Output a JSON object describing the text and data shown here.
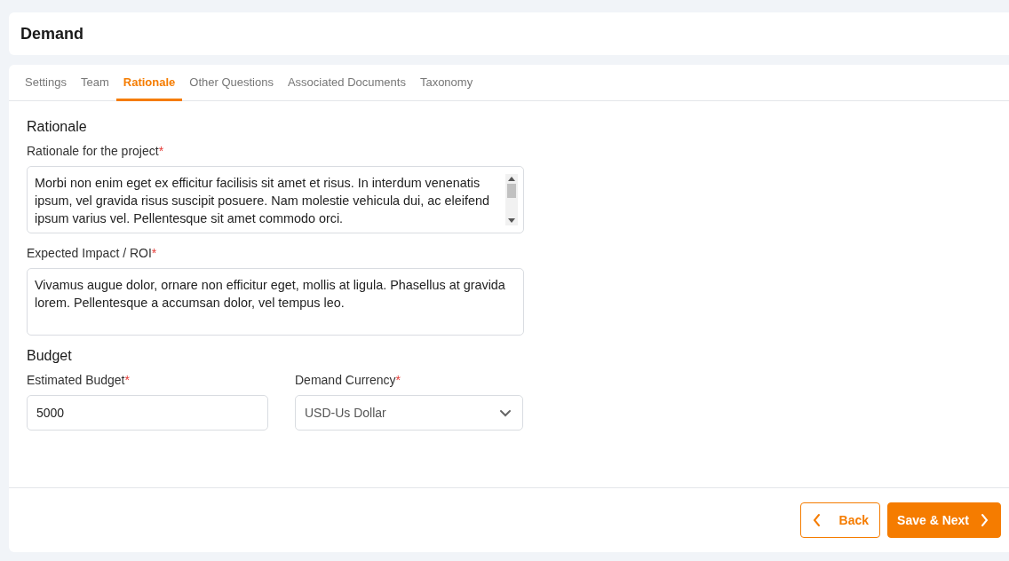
{
  "header": {
    "title": "Demand"
  },
  "tabs": [
    {
      "label": "Settings",
      "selected": false
    },
    {
      "label": "Team",
      "selected": false
    },
    {
      "label": "Rationale",
      "selected": true
    },
    {
      "label": "Other Questions",
      "selected": false
    },
    {
      "label": "Associated Documents",
      "selected": false
    },
    {
      "label": "Taxonomy",
      "selected": false
    }
  ],
  "sections": [
    {
      "title": "Rationale",
      "fields": [
        {
          "kind": "textarea",
          "label": "Rationale for the project",
          "required_mark": "*",
          "value": "Morbi non enim eget ex efficitur facilisis sit amet et risus. In interdum venenatis ipsum, vel gravida risus suscipit posuere. Nam molestie vehicula dui, ac eleifend ipsum varius vel. Pellentesque sit amet commodo orci.",
          "scrollable": true
        },
        {
          "kind": "textarea",
          "label": "Expected Impact / ROI",
          "required_mark": "*",
          "value": "Vivamus augue dolor, ornare non efficitur eget, mollis at ligula. Phasellus at gravida lorem. Pellentesque a accumsan dolor, vel tempus leo.",
          "scrollable": false
        }
      ]
    },
    {
      "title": "Budget",
      "fields": [
        {
          "kind": "text",
          "label": "Estimated Budget",
          "required_mark": "*",
          "value": "5000"
        },
        {
          "kind": "select",
          "label": "Demand Currency",
          "required_mark": "*",
          "value": "USD-Us Dollar"
        }
      ]
    }
  ],
  "footer": {
    "back": "Back",
    "next": "Save & Next"
  }
}
